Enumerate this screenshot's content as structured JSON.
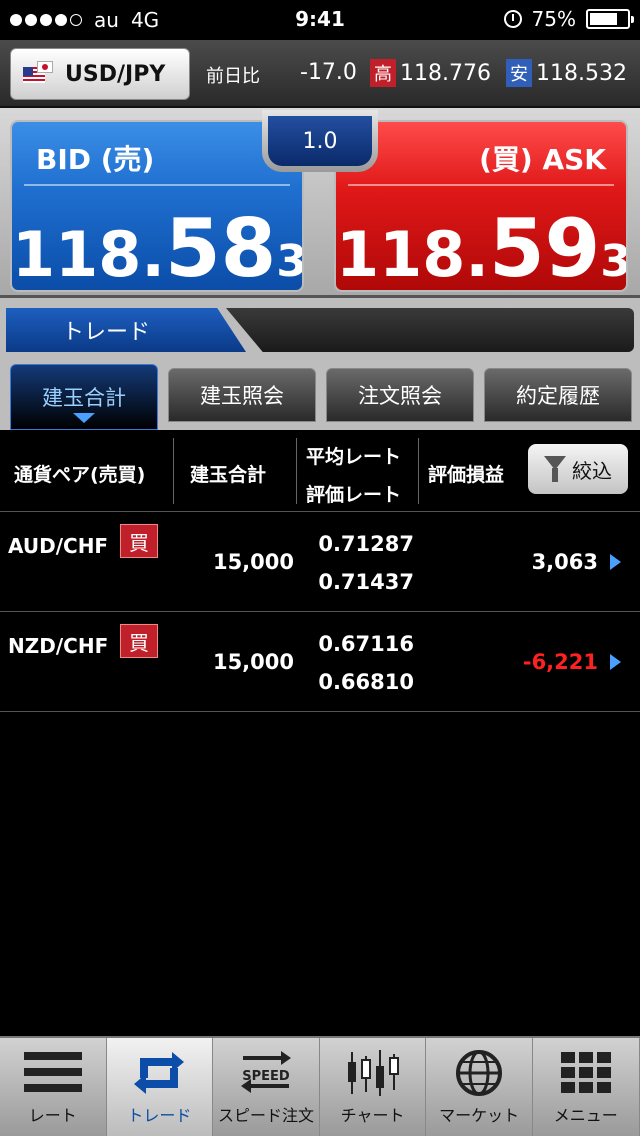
{
  "status": {
    "carrier": "au",
    "network": "4G",
    "time": "9:41",
    "battery": "75%"
  },
  "header": {
    "pair": "USD/JPY",
    "prev_label": "前日比",
    "prev_change": "-17.0",
    "high_tag": "高",
    "high": "118.776",
    "low_tag": "安",
    "low": "118.532"
  },
  "price": {
    "bid_label": "BID (売)",
    "ask_label": "(買) ASK",
    "spread": "1.0",
    "bid": {
      "big": "118.",
      "mid": "58",
      "small": "3"
    },
    "ask": {
      "big": "118.",
      "mid": "59",
      "small": "3"
    }
  },
  "section": {
    "title": "トレード"
  },
  "subtabs": [
    "建玉合計",
    "建玉照会",
    "注文照会",
    "約定履歴"
  ],
  "table": {
    "col_pair": "通貨ペア(売買)",
    "col_qty": "建玉合計",
    "col_rate1": "平均レート",
    "col_rate2": "評価レート",
    "col_pl": "評価損益",
    "filter": "絞込",
    "rows": [
      {
        "pair": "AUD/CHF",
        "side": "買",
        "qty": "15,000",
        "avg": "0.71287",
        "eval": "0.71437",
        "pl": "3,063"
      },
      {
        "pair": "NZD/CHF",
        "side": "買",
        "qty": "15,000",
        "avg": "0.67116",
        "eval": "0.66810",
        "pl": "-6,221"
      }
    ]
  },
  "tabbar": {
    "rate": "レート",
    "trade": "トレード",
    "speed": "スピード注文",
    "speed_icon_text": "SPEED",
    "chart": "チャート",
    "market": "マーケット",
    "menu": "メニュー"
  },
  "colors": {
    "bid": "#1f6fd0",
    "ask": "#e01818",
    "negative": "#ff2020",
    "accent": "#4aa0ff"
  }
}
